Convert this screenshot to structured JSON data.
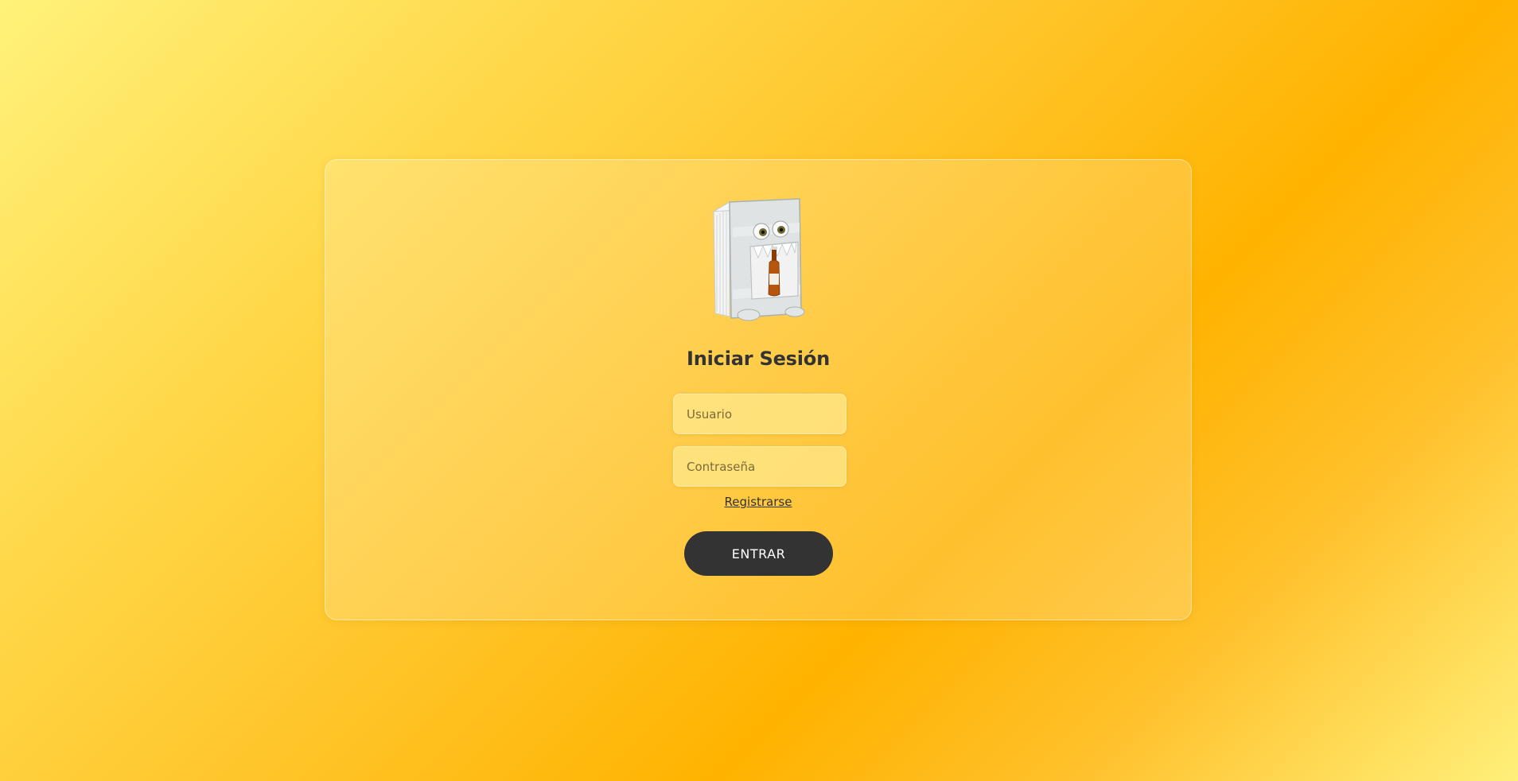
{
  "login": {
    "title": "Iniciar Sesión",
    "username": {
      "value": "",
      "placeholder": "Usuario"
    },
    "password": {
      "value": "",
      "placeholder": "Contraseña"
    },
    "register_link": "Registrarse",
    "submit_label": "ENTRAR",
    "logo_icon": "book-monster-with-bottle-icon"
  },
  "colors": {
    "background_light": "#fff27a",
    "background_accent": "#ffb300",
    "button_background": "#333333",
    "button_text": "#ffffff",
    "text": "#333333"
  }
}
